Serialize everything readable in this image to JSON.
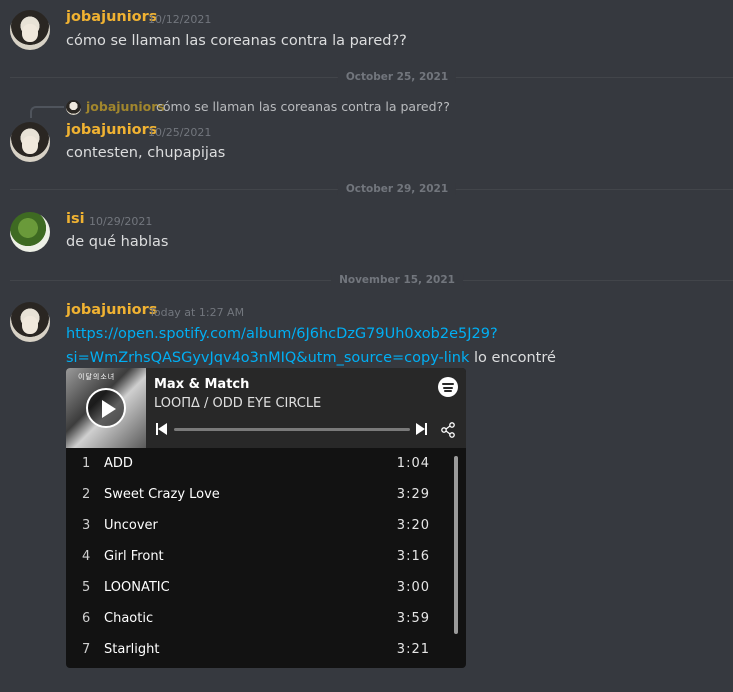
{
  "messages": [
    {
      "username": "jobajuniors",
      "timestamp": "10/12/2021",
      "content": "cómo se llaman las coreanas contra la pared??"
    },
    {
      "username": "jobajuniors",
      "timestamp": "10/25/2021",
      "content": "contesten, chupapijas",
      "reply": {
        "username": "jobajuniors",
        "content": "cómo se llaman las coreanas contra la pared??"
      }
    },
    {
      "username": "isi",
      "timestamp": "10/29/2021",
      "content": "de qué hablas"
    },
    {
      "username": "jobajuniors",
      "timestamp": "Today at 1:27 AM",
      "link_line1": "https://open.spotify.com/album/6J6hcDzG79Uh0xob2e5J29?",
      "link_line2": "si=WmZrhsQASGyvJqv4o3nMIQ&utm_source=copy-link",
      "content_after_link": "lo encontré"
    }
  ],
  "dividers": [
    "October 25, 2021",
    "October 29, 2021",
    "November 15, 2021"
  ],
  "spotify": {
    "cover_tag": "이달의소녀",
    "title": "Max & Match",
    "artist": "LOOΠΔ / ODD EYE CIRCLE",
    "tracks": [
      {
        "num": "1",
        "name": "ADD",
        "duration": "1:04"
      },
      {
        "num": "2",
        "name": "Sweet Crazy Love",
        "duration": "3:29"
      },
      {
        "num": "3",
        "name": "Uncover",
        "duration": "3:20"
      },
      {
        "num": "4",
        "name": "Girl Front",
        "duration": "3:16"
      },
      {
        "num": "5",
        "name": "LOONATIC",
        "duration": "3:00"
      },
      {
        "num": "6",
        "name": "Chaotic",
        "duration": "3:59"
      },
      {
        "num": "7",
        "name": "Starlight",
        "duration": "3:21"
      }
    ]
  },
  "colors": {
    "background": "#36393f",
    "username": "#f0b232",
    "link": "#00aff4",
    "spotify_bg": "#121212"
  }
}
